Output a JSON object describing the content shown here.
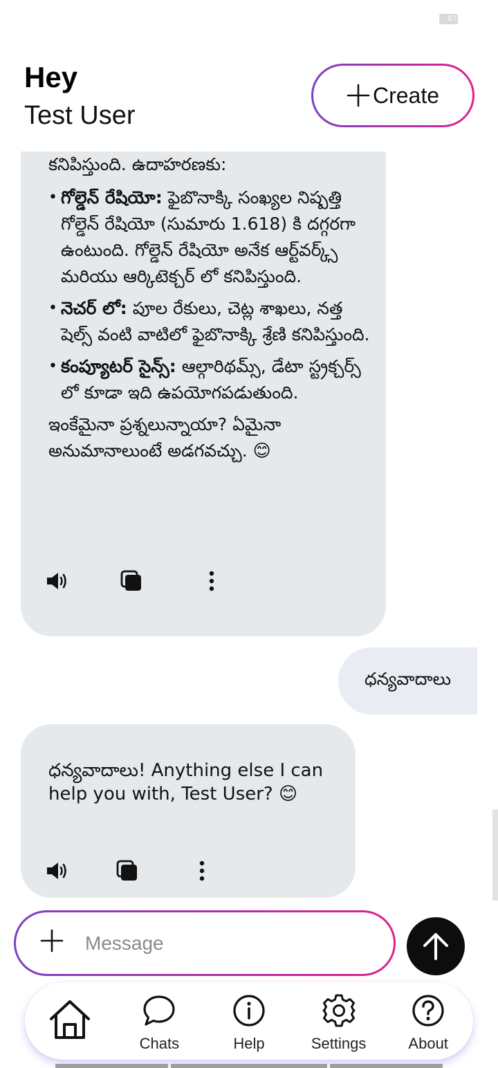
{
  "status_bar": {
    "battery_level": "67"
  },
  "header": {
    "greeting": "Hey",
    "user_name": "Test User",
    "create_label": "Create"
  },
  "conversation": {
    "bot_message_1": {
      "intro": "కనిపిస్తుంది.  ఉదాహరణకు:",
      "points": [
        {
          "title": "గోల్డెన్ రేషియో:",
          "text": " ఫైబొనాక్కి సంఖ్యల నిష్పత్తి గోల్డెన్ రేషియో (సుమారు 1.618) కి దగ్గరగా ఉంటుంది.  గోల్డెన్ రేషియో అనేక ఆర్ట్‌వర్క్స్ మరియు ఆర్కిటెక్చర్ లో కనిపిస్తుంది."
        },
        {
          "title": "నెచర్ లో:",
          "text": "  పూల రేకులు, చెట్ల శాఖలు, నత్త షెల్స్ వంటి వాటిలో ఫైబొనాక్కి శ్రేణి కనిపిస్తుంది."
        },
        {
          "title": "కంప్యూటర్ సైన్స్:",
          "text": "  ఆల్గారిథమ్స్, డేటా స్ట్రక్చర్స్ లో కూడా ఇది ఉపయోగపడుతుంది."
        }
      ],
      "outro": "ఇంకేమైనా ప్రశ్నలున్నాయా?  ఏమైనా అనుమానాలుంటే అడగవచ్చు.  😊"
    },
    "user_message_1": "ధన్యవాదాలు",
    "bot_message_2": "ధన్యవాదాలు!  Anything else I can help you with, Test User? 😊"
  },
  "icons": {
    "speaker": "speaker-icon",
    "copy": "copy-icon",
    "more": "more-vertical-icon",
    "send": "arrow-up-icon"
  },
  "composer": {
    "placeholder": "Message"
  },
  "nav": {
    "home_label": "",
    "chats_label": "Chats",
    "help_label": "Help",
    "settings_label": "Settings",
    "about_label": "About"
  },
  "colors": {
    "gradient_start": "#7b3fc4",
    "gradient_end": "#e0218a",
    "bot_bubble": "#e6e9ec",
    "user_bubble": "#e9ecf3",
    "send_button": "#0d0d0d"
  }
}
